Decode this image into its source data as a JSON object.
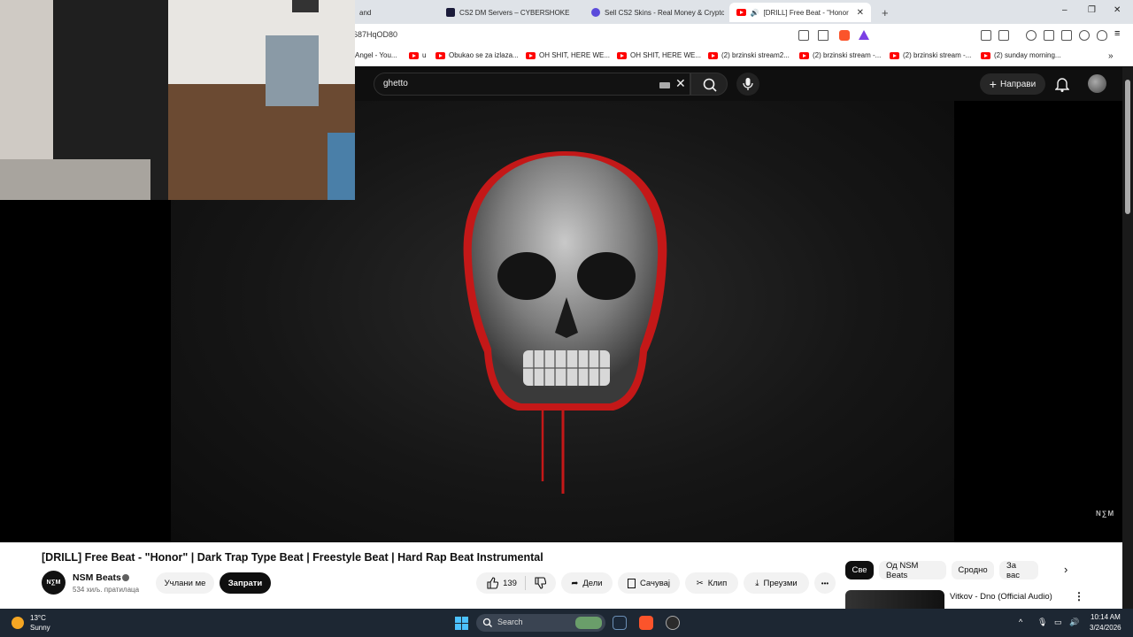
{
  "browser": {
    "tabs": [
      {
        "label": "and",
        "favicon_color": "#ff0000"
      },
      {
        "label": "CS2 DM Servers – CYBERSHOKE",
        "favicon_color": "#1b1b3a"
      },
      {
        "label": "Sell CS2 Skins - Real Money & Crypto",
        "favicon_color": "#5b4bdb"
      },
      {
        "label": "[DRILL] Free Beat - \"Honor\" |",
        "favicon_color": "#ff0000"
      }
    ],
    "new_tab": "+",
    "window_controls": {
      "minimize": "–",
      "restore": "❐",
      "close": "✕"
    },
    "url": "687HqOD80",
    "bookmarks": [
      "Angel - You...",
      "u",
      "Obukao se za izlaza...",
      "OH SHIT, HERE WE...",
      "OH SHIT, HERE WE...",
      "(2) brzinski stream2...",
      "(2) brzinski stream -...",
      "(2) brzinski stream -...",
      "(2) sunday morning..."
    ],
    "bookmarks_more": "»"
  },
  "youtube": {
    "search": {
      "query": "ghetto"
    },
    "create_label": "Направи",
    "video": {
      "watermark": "N∑M",
      "title": "[DRILL] Free Beat - \"Honor\" | Dark Trap Type Beat | Freestyle Beat | Hard Rap Beat Instrumental"
    },
    "channel": {
      "name": "NSM Beats",
      "avatar_text": "N∑M",
      "subscribers": "534 хиљ. пратилаца",
      "join_label": "Учлани ме",
      "subscribe_label": "Запрати"
    },
    "actions": {
      "likes": "139",
      "share": "Дели",
      "save": "Сачувај",
      "clip": "Клип",
      "download": "Преузми",
      "more": "•••"
    },
    "chips": [
      "Све",
      "Од NSM Beats",
      "Сродно",
      "За вас"
    ],
    "recommendation": {
      "title": "Vitkov - Dno (Official Audio)"
    }
  },
  "taskbar": {
    "weather": {
      "temp": "13°C",
      "condition": "Sunny"
    },
    "search_placeholder": "Search",
    "time": "10:14 AM",
    "date": "3/24/2026"
  },
  "colors": {
    "accent_red": "#ff0000",
    "skull_blood": "#d81b1b",
    "taskbar": "#1d2733"
  }
}
